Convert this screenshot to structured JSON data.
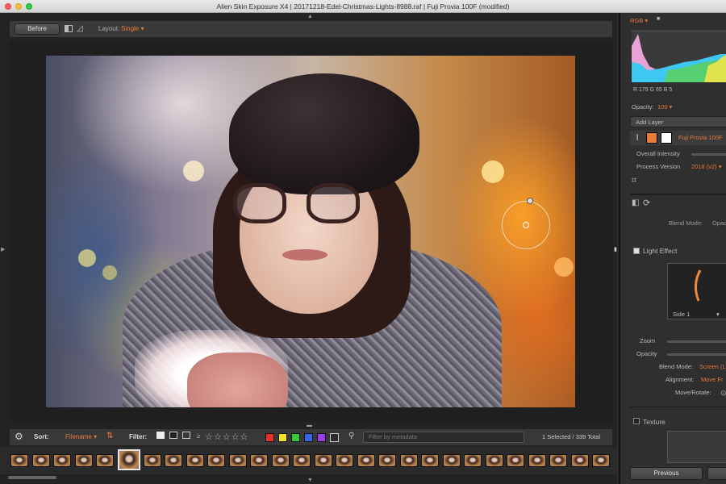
{
  "window": {
    "title": "Alien Skin Exposure X4 | 20171218-Edel-Christmas-Lights-8988.raf | Fuji Provia 100F (modified)"
  },
  "toolbar": {
    "before_label": "Before",
    "layout_label": "Layout:",
    "layout_value": "Single ▾"
  },
  "filter_bar": {
    "sort_label": "Sort:",
    "sort_value": "Filename ▾",
    "filter_label": "Filter:",
    "stars": "☆☆☆☆☆",
    "color_chips": [
      "#e8312e",
      "#f5e52a",
      "#35c93b",
      "#3566e8",
      "#9a3fe8",
      "#2b2b2b"
    ],
    "search_placeholder": "Filter by metadata",
    "count": "1 Selected / 339 Total"
  },
  "filmstrip": {
    "thumbnail_count": 28,
    "selected_index": 5
  },
  "panel": {
    "histogram_mode": "RGB ▾",
    "rgb_readout": "R 179   G 65   B 5",
    "opacity_label": "Opacity:",
    "opacity_value": "100 ▾",
    "add_layer": "Add Layer",
    "layer_name": "Fuji Provia 100F",
    "overall_intensity": "Overall Intensity",
    "process_version_label": "Process Version",
    "process_version_value": "2018 (v2) ▾",
    "blend_mode_label": "Blend Mode:",
    "blend_mode_value": "Opac",
    "light_effect_label": "Light Effect",
    "light_effect_preset": "Side 1",
    "zoom_label": "Zoom",
    "opacity2_label": "Opacity",
    "blend_mode2_label": "Blend Mode:",
    "blend_mode2_value": "Screen (L",
    "alignment_label": "Alignment:",
    "alignment_value": "Move Fr",
    "move_rotate_label": "Move/Rotate:",
    "texture_label": "Texture",
    "previous_button": "Previous"
  }
}
